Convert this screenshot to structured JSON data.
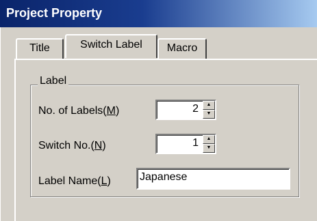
{
  "window": {
    "title": "Project Property"
  },
  "tabs": [
    {
      "label": "Title"
    },
    {
      "label": "Switch Label"
    },
    {
      "label": "Macro"
    }
  ],
  "group": {
    "label": "Label",
    "fields": {
      "labels_count": {
        "label_text": "No. of Labels(",
        "mnemonic": "M",
        "label_close": ")",
        "value": "2"
      },
      "switch_no": {
        "label_text": "Switch No.(",
        "mnemonic": "N",
        "label_close": ")",
        "value": "1"
      },
      "label_name": {
        "label_text": "Label Name(",
        "mnemonic": "L",
        "label_close": ")",
        "value": "Japanese"
      }
    }
  },
  "icons": {
    "spin_up": "spin-up-arrow-icon",
    "spin_down": "spin-down-arrow-icon"
  }
}
